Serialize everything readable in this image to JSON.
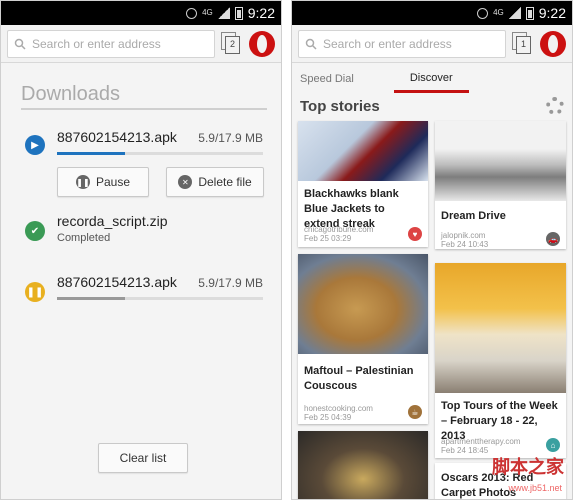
{
  "left": {
    "status": {
      "network": "4G",
      "time": "9:22"
    },
    "toolbar": {
      "search_placeholder": "Search or enter address",
      "tab_count": "2"
    },
    "header": "Downloads",
    "items": [
      {
        "name": "887602154213.apk",
        "size": "5.9/17.9 MB",
        "state": "downloading",
        "progress": 0.33
      },
      {
        "name": "recorda_script.zip",
        "sub": "Completed",
        "state": "completed"
      },
      {
        "name": "887602154213.apk",
        "size": "5.9/17.9 MB",
        "state": "paused",
        "progress": 0.33
      }
    ],
    "buttons": {
      "pause": "Pause",
      "delete": "Delete file",
      "clear": "Clear list"
    }
  },
  "right": {
    "status": {
      "network": "4G",
      "time": "9:22"
    },
    "toolbar": {
      "search_placeholder": "Search or enter address",
      "tab_count": "1"
    },
    "tabs": [
      "Speed Dial",
      "Discover"
    ],
    "section_title": "Top stories",
    "cards": [
      {
        "title": "Blackhawks blank Blue Jackets to extend streak",
        "source": "chicagotribune.com",
        "date": "Feb 25 03:29"
      },
      {
        "title": "Dream Drive",
        "source": "jalopnik.com",
        "date": "Feb 24 10:43"
      },
      {
        "title": "Maftoul – Palestinian Couscous",
        "source": "honestcooking.com",
        "date": "Feb 25 04:39"
      },
      {
        "title": "Top Tours of the Week – February 18 - 22, 2013",
        "source": "apartmenttherapy.com",
        "date": "Feb 24 18:45"
      },
      {
        "title": "Oscars 2013: Red Carpet Photos",
        "source": "",
        "date": ""
      }
    ],
    "watermark": "脚本之家",
    "watermark_sub": "www.jb51.net"
  },
  "colors": {
    "accent": "#c41111",
    "download_blue": "#1e73be",
    "complete_green": "#3a9a55",
    "paused_yellow": "#e8b020"
  }
}
